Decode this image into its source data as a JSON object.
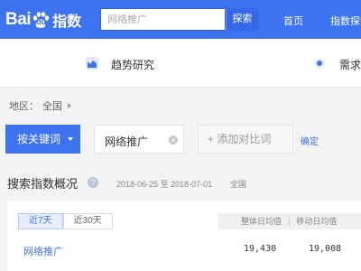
{
  "header": {
    "logo_bai": "Bai",
    "logo_du": "du",
    "logo_zhishu": "指数",
    "search_placeholder": "网络推广",
    "search_button": "探索",
    "nav": [
      "首页",
      "指数探索"
    ]
  },
  "subnav": {
    "trend": "趋势研究",
    "demand": "需求"
  },
  "region": {
    "label": "地区：",
    "value": "全国"
  },
  "keyword_bar": {
    "keyword_button": "按关键词",
    "keyword": "网络推广",
    "add_compare": "+ 添加对比词",
    "confirm": "确定"
  },
  "overview": {
    "title": "搜索指数概况",
    "date_range": "2018-06-25 至 2018-07-01",
    "region": "全国",
    "tabs": [
      "近7天",
      "近30天"
    ],
    "metric_headers": [
      "整体日均值",
      "移动日均值"
    ],
    "rows": [
      {
        "keyword": "网络推广",
        "overall": "19,430",
        "mobile": "19,008"
      }
    ]
  },
  "colors": {
    "brand": "#3e73f0",
    "background": "#f2f3f5"
  },
  "icons": {
    "help": "?",
    "remove": "×"
  }
}
